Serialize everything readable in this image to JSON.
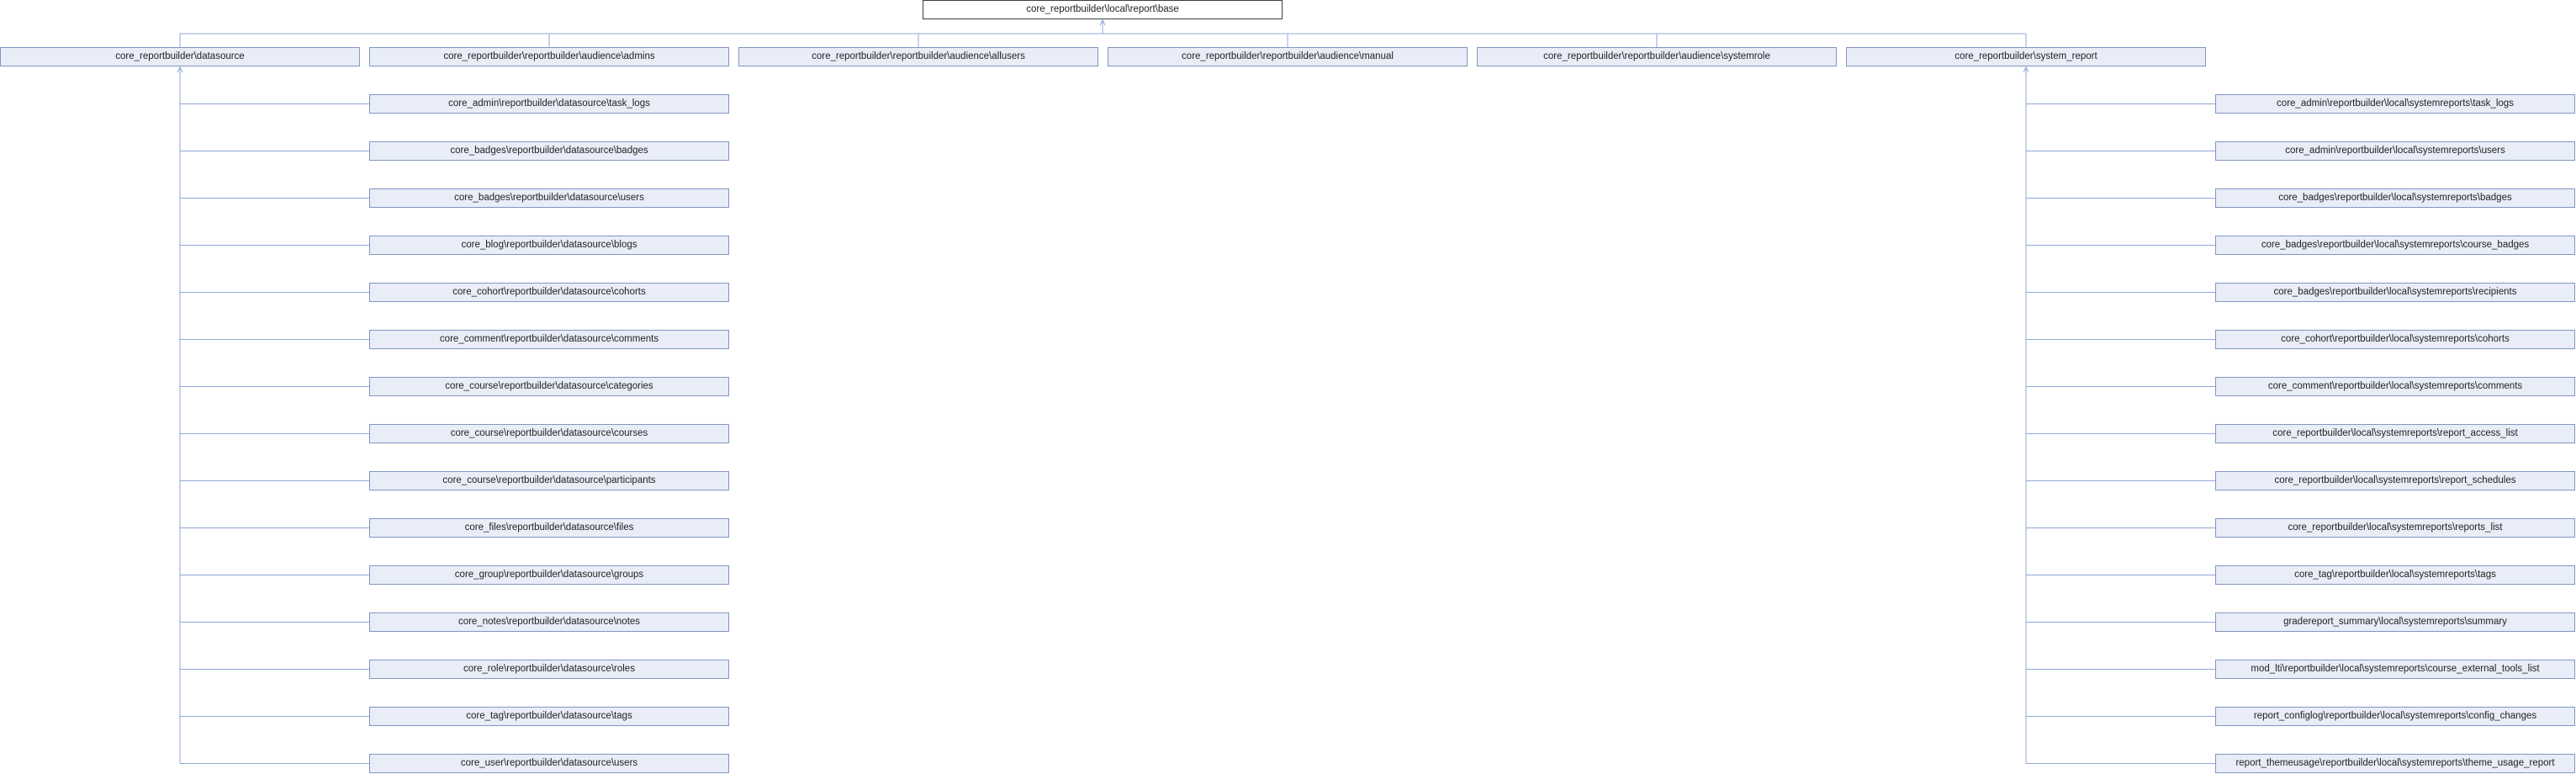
{
  "diagram": {
    "root": "core_reportbuilder\\local\\report\\base",
    "children": [
      "core_reportbuilder\\datasource",
      "core_reportbuilder\\reportbuilder\\audience\\admins",
      "core_reportbuilder\\reportbuilder\\audience\\allusers",
      "core_reportbuilder\\reportbuilder\\audience\\manual",
      "core_reportbuilder\\reportbuilder\\audience\\systemrole",
      "core_reportbuilder\\system_report"
    ],
    "datasources": [
      "core_admin\\reportbuilder\\datasource\\task_logs",
      "core_badges\\reportbuilder\\datasource\\badges",
      "core_badges\\reportbuilder\\datasource\\users",
      "core_blog\\reportbuilder\\datasource\\blogs",
      "core_cohort\\reportbuilder\\datasource\\cohorts",
      "core_comment\\reportbuilder\\datasource\\comments",
      "core_course\\reportbuilder\\datasource\\categories",
      "core_course\\reportbuilder\\datasource\\courses",
      "core_course\\reportbuilder\\datasource\\participants",
      "core_files\\reportbuilder\\datasource\\files",
      "core_group\\reportbuilder\\datasource\\groups",
      "core_notes\\reportbuilder\\datasource\\notes",
      "core_role\\reportbuilder\\datasource\\roles",
      "core_tag\\reportbuilder\\datasource\\tags",
      "core_user\\reportbuilder\\datasource\\users"
    ],
    "system_reports": [
      "core_admin\\reportbuilder\\local\\systemreports\\task_logs",
      "core_admin\\reportbuilder\\local\\systemreports\\users",
      "core_badges\\reportbuilder\\local\\systemreports\\badges",
      "core_badges\\reportbuilder\\local\\systemreports\\course_badges",
      "core_badges\\reportbuilder\\local\\systemreports\\recipients",
      "core_cohort\\reportbuilder\\local\\systemreports\\cohorts",
      "core_comment\\reportbuilder\\local\\systemreports\\comments",
      "core_reportbuilder\\local\\systemreports\\report_access_list",
      "core_reportbuilder\\local\\systemreports\\report_schedules",
      "core_reportbuilder\\local\\systemreports\\reports_list",
      "core_tag\\reportbuilder\\local\\systemreports\\tags",
      "gradereport_summary\\local\\systemreports\\summary",
      "mod_lti\\reportbuilder\\local\\systemreports\\course_external_tools_list",
      "report_configlog\\reportbuilder\\local\\systemreports\\config_changes",
      "report_themeusage\\reportbuilder\\local\\systemreports\\theme_usage_report"
    ],
    "colors": {
      "node_fill": "#e8edf7",
      "node_border": "#8495c0",
      "edge": "#8fa8d8",
      "root_border": "#404040"
    }
  }
}
